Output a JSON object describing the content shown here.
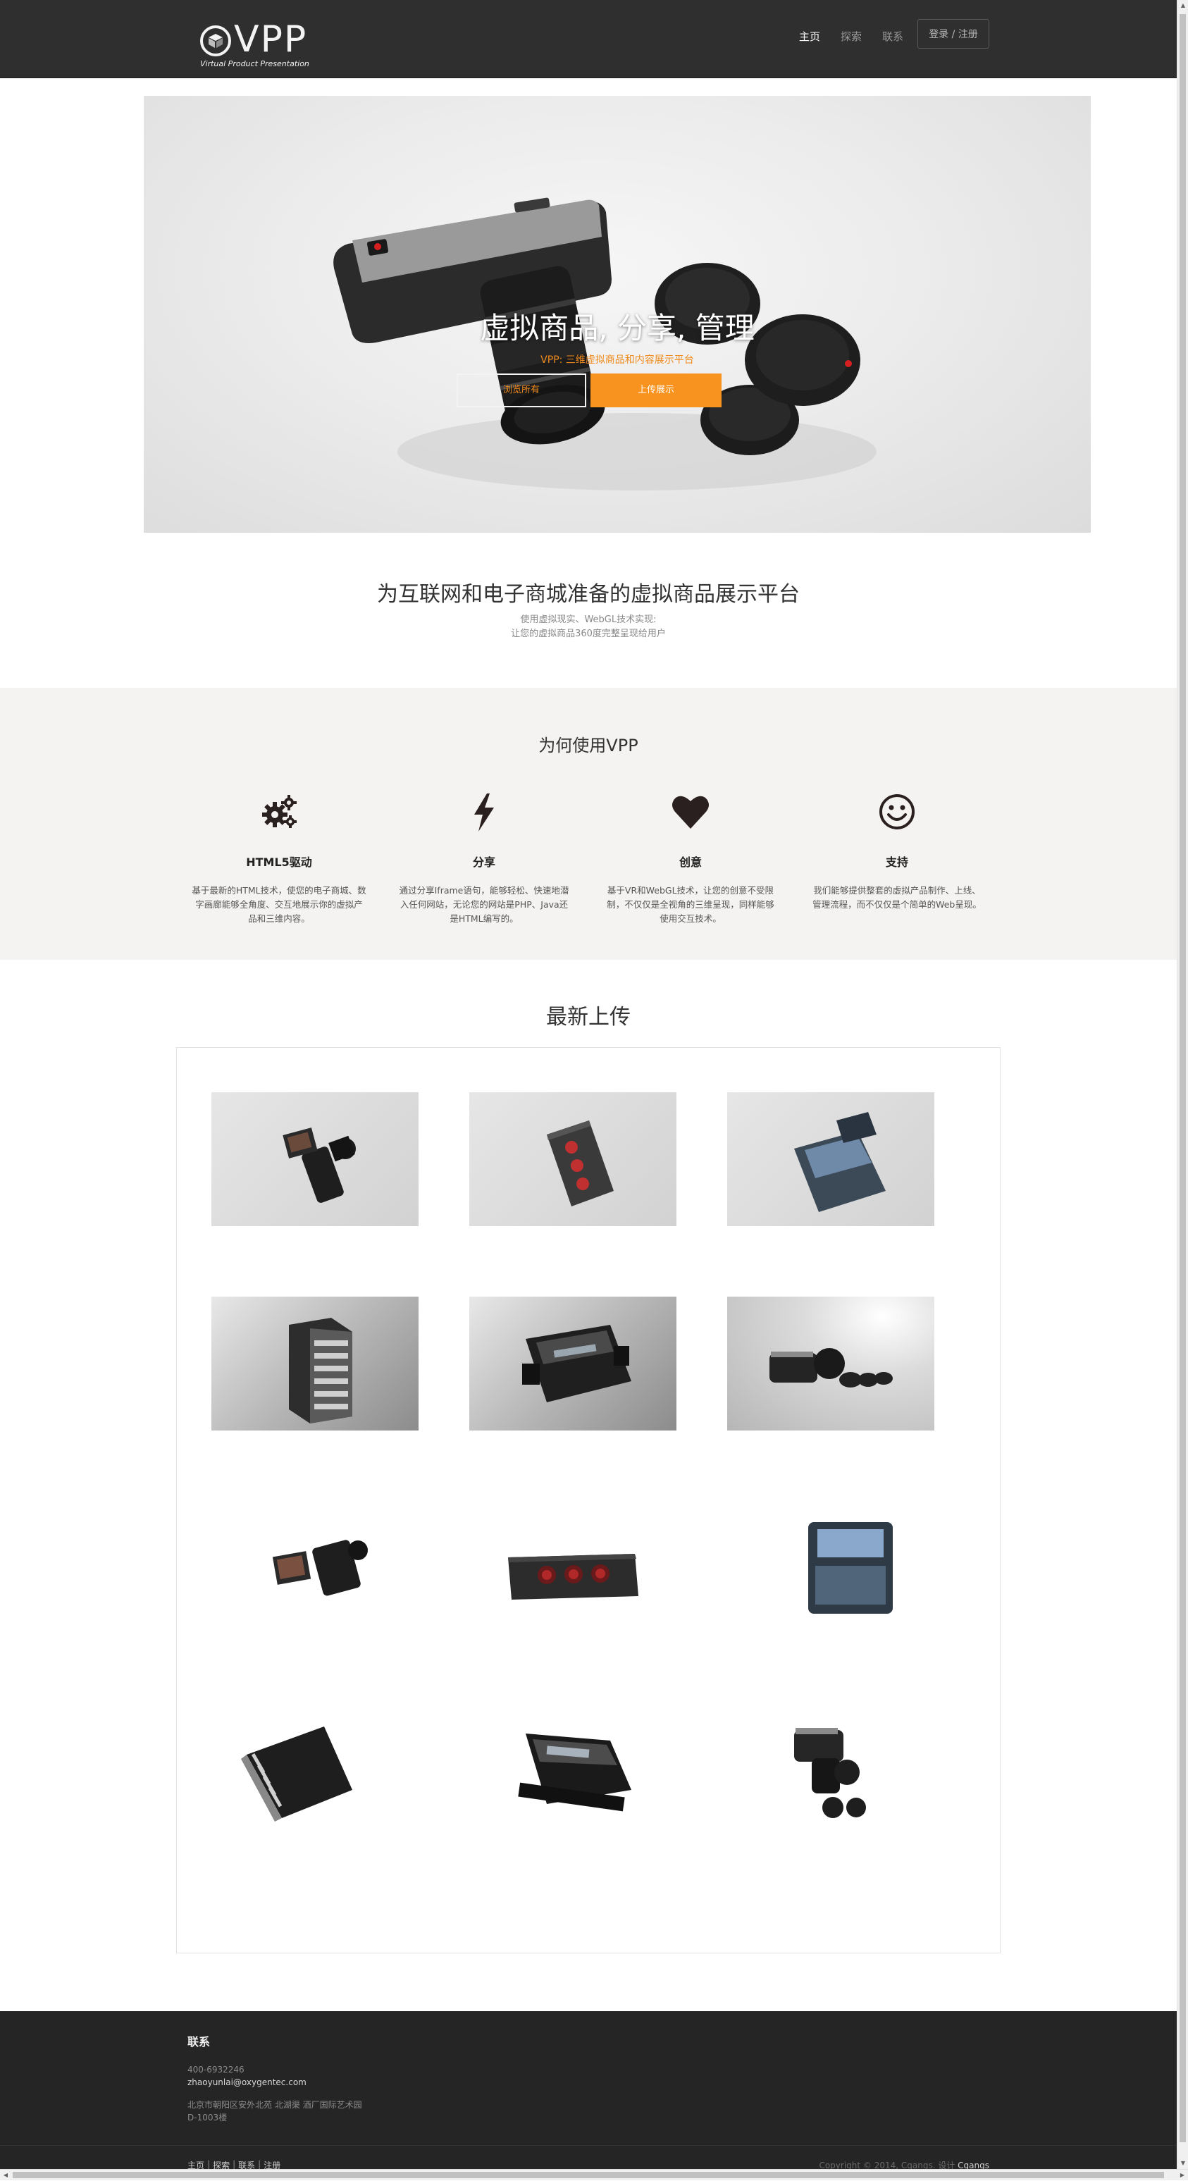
{
  "nav": {
    "logo_text": "VPP",
    "logo_subtitle": "Virtual Product Presentation",
    "links": [
      "主页",
      "探索",
      "联系"
    ],
    "login_label": "登录 / 注册"
  },
  "hero": {
    "title": "虚拟商品, 分享, 管理",
    "subtitle": "VPP: 三维虚拟商品和内容展示平台",
    "button_browse": "浏览所有",
    "button_upload": "上传展示"
  },
  "intro": {
    "title": "为互联网和电子商城准备的虚拟商品展示平台",
    "line1": "使用虚拟现实、WebGL技术实现:",
    "line2": "让您的虚拟商品360度完整呈现给用户"
  },
  "features": {
    "title": "为何使用VPP",
    "items": [
      {
        "icon": "gears-icon",
        "title": "HTML5驱动",
        "text": "基于最新的HTML技术，使您的电子商城、数字画廊能够全角度、交互地展示你的虚拟产品和三维内容。"
      },
      {
        "icon": "bolt-icon",
        "title": "分享",
        "text": "通过分享Iframe语句，能够轻松、快速地潜入任何网站，无论您的网站是PHP、Java还是HTML编写的。"
      },
      {
        "icon": "heart-icon",
        "title": "创意",
        "text": "基于VR和WebGL技术，让您的创意不受限制，不仅仅是全视角的三维呈现，同样能够使用交互技术。"
      },
      {
        "icon": "smile-icon",
        "title": "支持",
        "text": "我们能够提供整套的虚拟产品制作、上线、管理流程，而不仅仅是个简单的Web呈现。"
      }
    ]
  },
  "latest": {
    "title": "最新上传",
    "items": [
      {
        "name": "camera-rig"
      },
      {
        "name": "control-panel-red-buttons"
      },
      {
        "name": "video-switcher"
      },
      {
        "name": "storage-tower"
      },
      {
        "name": "recorder-case"
      },
      {
        "name": "pocket-cinema-camera"
      },
      {
        "name": "camera-rig"
      },
      {
        "name": "control-panel-red-buttons"
      },
      {
        "name": "video-switcher"
      },
      {
        "name": "storage-tower"
      },
      {
        "name": "recorder-case"
      },
      {
        "name": "pocket-cinema-camera"
      }
    ]
  },
  "footer": {
    "contact_title": "联系",
    "phone": "400-6932246",
    "email": "zhaoyunlai@oxygentec.com",
    "address1": "北京市朝阳区安外北苑 北湖渠 酒厂国际艺术园",
    "address2": "D-1003楼",
    "links": [
      "主页",
      "探索",
      "联系",
      "注册"
    ],
    "copyright": "Copyright © 2014, Cqangs. 设计",
    "designer": "Cqangs"
  },
  "colors": {
    "navbar": "#2f2f2f",
    "accent": "#f7931e",
    "features_bg": "#f4f3f1",
    "footer": "#252525"
  }
}
